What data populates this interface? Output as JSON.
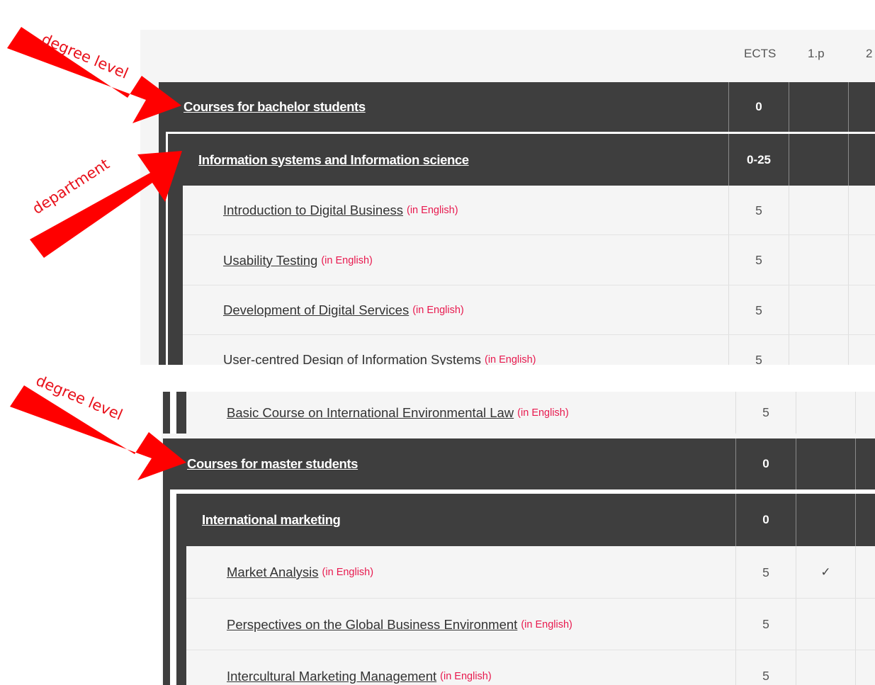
{
  "table_header": {
    "ects": "ECTS",
    "period1": "1.p",
    "period2": "2"
  },
  "top_section": {
    "degree_level": {
      "label": "Courses for bachelor students",
      "ects": "0"
    },
    "department": {
      "label": "Information systems and Information science",
      "ects": "0-25"
    },
    "courses": [
      {
        "name": "Introduction to Digital Business",
        "lang": "(in English)",
        "ects": "5"
      },
      {
        "name": "Usability Testing",
        "lang": "(in English)",
        "ects": "5"
      },
      {
        "name": "Development of Digital Services",
        "lang": "(in English)",
        "ects": "5"
      },
      {
        "name": "User-centred Design of Information Systems",
        "lang": "(in English)",
        "ects": "5"
      }
    ]
  },
  "bottom_section": {
    "prev_course": {
      "name": "Basic Course on International Environmental Law",
      "lang": "(in English)",
      "ects": "5"
    },
    "degree_level": {
      "label": "Courses for master students",
      "ects": "0"
    },
    "department": {
      "label": "International marketing",
      "ects": "0"
    },
    "courses": [
      {
        "name": "Market Analysis",
        "lang": "(in English)",
        "ects": "5",
        "period1_mark": "✓"
      },
      {
        "name": "Perspectives on the Global Business Environment",
        "lang": "(in English)",
        "ects": "5"
      },
      {
        "name": "Intercultural Marketing Management",
        "lang": "(in English)",
        "ects": "5"
      }
    ]
  },
  "annotations": {
    "degree_level": "degree level",
    "department": "department"
  },
  "colors": {
    "header_bg": "#3e3e3e",
    "row_bg": "#f5f5f5",
    "lang_tag": "#e8194e",
    "annotation": "#ff0000"
  }
}
